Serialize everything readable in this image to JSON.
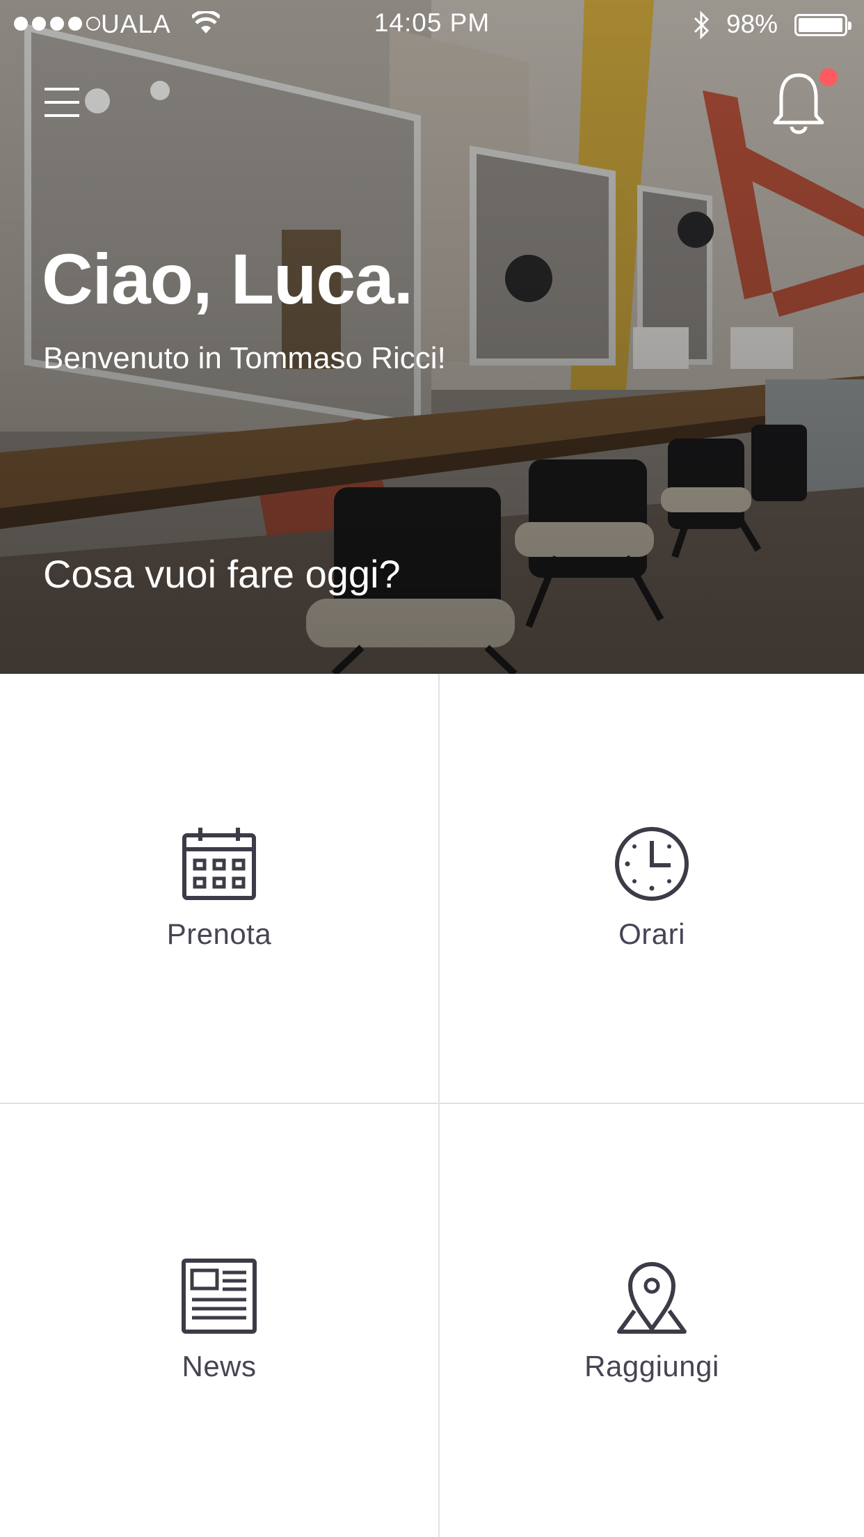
{
  "status_bar": {
    "carrier": "UALA",
    "time": "14:05 PM",
    "battery_percent": "98%",
    "battery_level": 0.98,
    "signal_bars_filled": 4,
    "signal_bars_total": 5
  },
  "header": {
    "greeting": "Ciao, Luca.",
    "welcome": "Benvenuto in Tommaso Ricci!",
    "question": "Cosa vuoi fare oggi?",
    "has_notification": true
  },
  "actions": [
    {
      "label": "Prenota",
      "icon": "calendar-icon"
    },
    {
      "label": "Orari",
      "icon": "clock-icon"
    },
    {
      "label": "News",
      "icon": "newspaper-icon"
    },
    {
      "label": "Raggiungi",
      "icon": "map-pin-icon"
    }
  ],
  "colors": {
    "icon": "#3c3c48",
    "label": "#454554",
    "notification_dot": "#ff5a5f",
    "divider": "#e2e2e2"
  }
}
